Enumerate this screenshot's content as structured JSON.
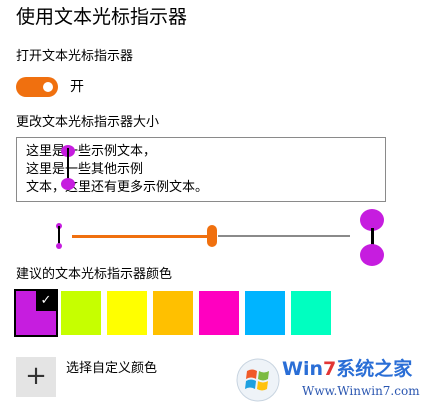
{
  "header": {
    "title": "使用文本光标指示器"
  },
  "toggle_section": {
    "label": "打开文本光标指示器",
    "state_label": "开"
  },
  "size_section": {
    "label": "更改文本光标指示器大小",
    "preview_lines": [
      "这里是一些示例文本，",
      "这里是一些其他示例",
      "文本，这里还有更多示例文本。"
    ],
    "slider_level_fraction": 0.5
  },
  "color_section": {
    "label": "建议的文本光标指示器颜色",
    "swatches": [
      "#c61ddf",
      "#c6ff00",
      "#ffff00",
      "#ffc000",
      "#ff00c0",
      "#00b4ff",
      "#00ffc0"
    ],
    "selected_index": 0,
    "check_glyph": "✓"
  },
  "custom_color": {
    "label": "选择自定义颜色",
    "plus_glyph": "+"
  },
  "colors": {
    "accent": "#f0700f",
    "indicator": "#c61ddf"
  },
  "watermark": {
    "brand_prefix": "Win",
    "brand_num": "7",
    "brand_suffix": "系统之家",
    "url": "Www.Winwin7.com"
  }
}
